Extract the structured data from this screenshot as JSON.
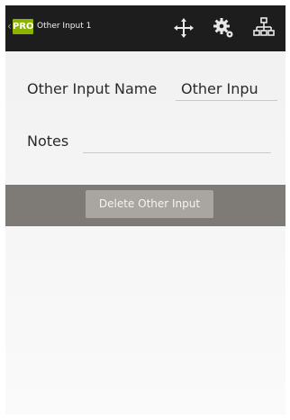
{
  "actionbar": {
    "back_chevron": "‹",
    "pro_badge": "PRO",
    "title": "Other Input 1",
    "icons": [
      "move-icon",
      "gear-icon",
      "hierarchy-icon"
    ]
  },
  "form": {
    "name_label": "Other Input Name",
    "name_value": "Other Inpu",
    "notes_label": "Notes",
    "notes_value": ""
  },
  "actions": {
    "delete_label": "Delete Other Input"
  },
  "colors": {
    "actionbar_bg": "#1d1d1d",
    "pro_badge": "#8ab300",
    "action_strip": "#7e7a76",
    "button": "#a9a5a0"
  }
}
